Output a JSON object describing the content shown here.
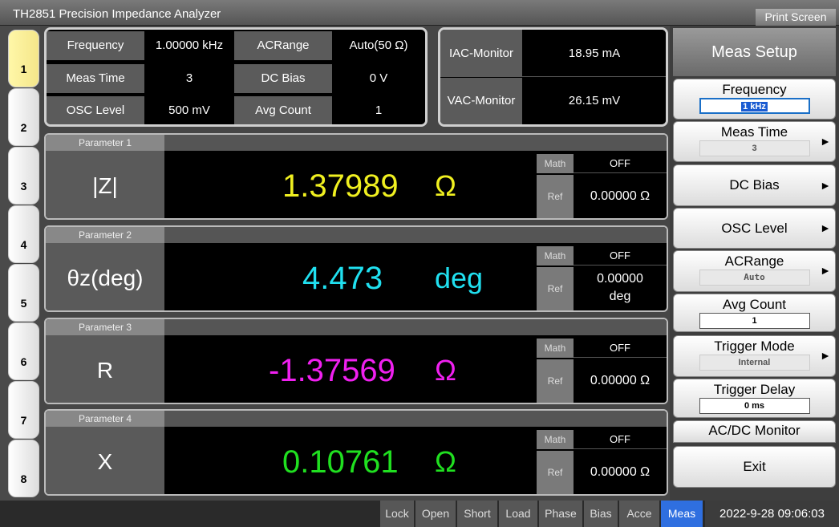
{
  "title": "TH2851 Precision Impedance Analyzer",
  "print_screen": "Print Screen",
  "left_tabs": [
    "1",
    "2",
    "3",
    "4",
    "5",
    "6",
    "7",
    "8"
  ],
  "info": {
    "frequency_label": "Frequency",
    "frequency_value": "1.00000 kHz",
    "acrange_label": "ACRange",
    "acrange_value": "Auto(50 Ω)",
    "meas_time_label": "Meas Time",
    "meas_time_value": "3",
    "dc_bias_label": "DC Bias",
    "dc_bias_value": "0 V",
    "osc_label": "OSC Level",
    "osc_value": "500 mV",
    "avg_label": "Avg Count",
    "avg_value": "1"
  },
  "monitor": {
    "iac_label": "IAC-Monitor",
    "iac_value": "18.95 mA",
    "vac_label": "VAC-Monitor",
    "vac_value": "26.15 mV"
  },
  "parameters": [
    {
      "header": "Parameter 1",
      "name": "|Z|",
      "value": "1.37989",
      "unit": "Ω",
      "color": "#f0f020",
      "math_label": "Math",
      "math_value": "OFF",
      "ref_label": "Ref",
      "ref_value": "0.00000 Ω"
    },
    {
      "header": "Parameter 2",
      "name": "θz(deg)",
      "value": "4.473",
      "unit": "deg",
      "color": "#20e0f0",
      "math_label": "Math",
      "math_value": "OFF",
      "ref_label": "Ref",
      "ref_value_1": "0.00000",
      "ref_value_2": "deg"
    },
    {
      "header": "Parameter 3",
      "name": "R",
      "value": "-1.37569",
      "unit": "Ω",
      "color": "#f020f0",
      "math_label": "Math",
      "math_value": "OFF",
      "ref_label": "Ref",
      "ref_value": "0.00000 Ω"
    },
    {
      "header": "Parameter 4",
      "name": "X",
      "value": "0.10761",
      "unit": "Ω",
      "color": "#20e020",
      "math_label": "Math",
      "math_value": "OFF",
      "ref_label": "Ref",
      "ref_value": "0.00000 Ω"
    }
  ],
  "menu": {
    "header": "Meas Setup",
    "frequency": {
      "label": "Frequency",
      "value": "1 kHz"
    },
    "meas_time": {
      "label": "Meas Time",
      "value": "3"
    },
    "dc_bias": {
      "label": "DC Bias"
    },
    "osc_level": {
      "label": "OSC Level"
    },
    "acrange": {
      "label": "ACRange",
      "value": "Auto"
    },
    "avg_count": {
      "label": "Avg Count",
      "value": "1"
    },
    "trigger_mode": {
      "label": "Trigger Mode",
      "value": "Internal"
    },
    "trigger_delay": {
      "label": "Trigger Delay",
      "value": "0 ms"
    },
    "acdc_monitor": {
      "label": "AC/DC Monitor"
    },
    "exit": {
      "label": "Exit"
    },
    "arrow": "►"
  },
  "status": {
    "lock": "Lock",
    "open": "Open",
    "short": "Short",
    "load": "Load",
    "phase": "Phase",
    "bias": "Bias",
    "acce": "Acce",
    "meas": "Meas",
    "datetime": "2022-9-28 09:06:03"
  }
}
